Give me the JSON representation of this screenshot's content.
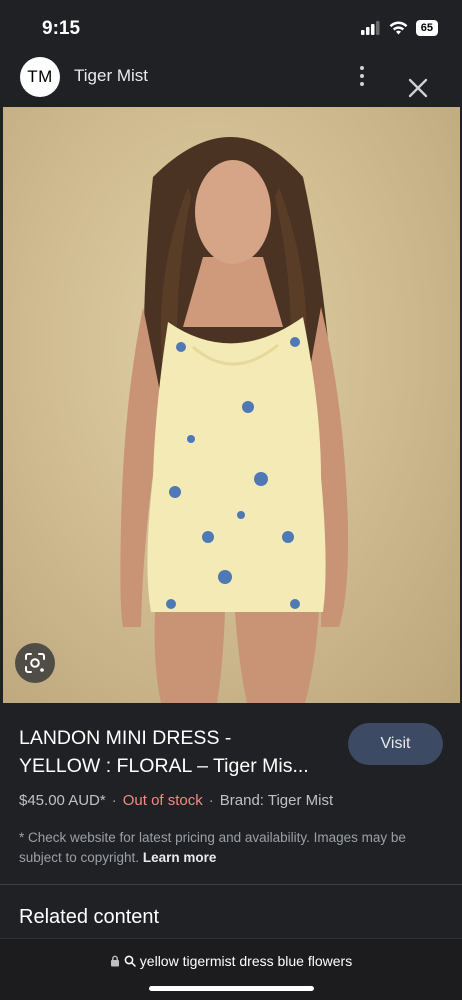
{
  "status": {
    "time": "9:15",
    "battery": "65"
  },
  "header": {
    "avatar_text": "TM",
    "site_name": "Tiger Mist"
  },
  "product": {
    "title": "LANDON MINI DRESS -\nYELLOW : FLORAL – Tiger Mis...",
    "visit_label": "Visit",
    "price": "$45.00 AUD*",
    "stock": "Out of stock",
    "brand": "Brand: Tiger Mist",
    "disclaimer": "* Check website for latest pricing and availability. Images may be subject to copyright.",
    "learn_more": "Learn more"
  },
  "related": {
    "heading": "Related content"
  },
  "browser": {
    "url_text": "yellow tigermist dress blue flowers"
  },
  "colors": {
    "accent": "#3c4a63",
    "stock_status": "#f28b82",
    "background": "#202124"
  },
  "icons": [
    "signal-icon",
    "wifi-icon",
    "battery-icon",
    "more-vert-icon",
    "close-icon",
    "google-lens-icon",
    "lock-icon",
    "search-icon"
  ]
}
